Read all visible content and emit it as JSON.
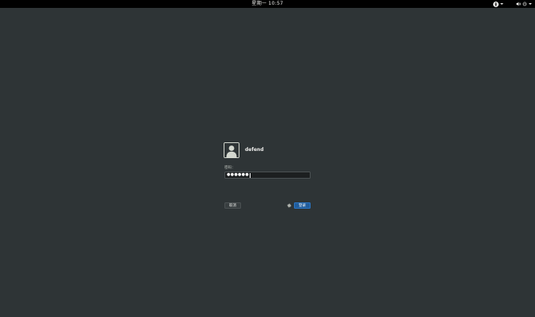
{
  "topbar": {
    "clock": "星期一 10:57",
    "accessibility_icon": "accessibility-icon",
    "volume_icon": "volume-icon",
    "power_icon": "power-icon"
  },
  "login": {
    "avatar_icon": "user-avatar-icon",
    "username": "defend",
    "password_label": "密码：",
    "password_value": "●●●●●●",
    "cancel_label": "取消",
    "session_icon": "gear-icon",
    "signin_label": "登录"
  },
  "colors": {
    "background": "#2e3436",
    "topbar": "#000000",
    "accent": "#215d9c",
    "field_bg": "#1c1f20"
  }
}
